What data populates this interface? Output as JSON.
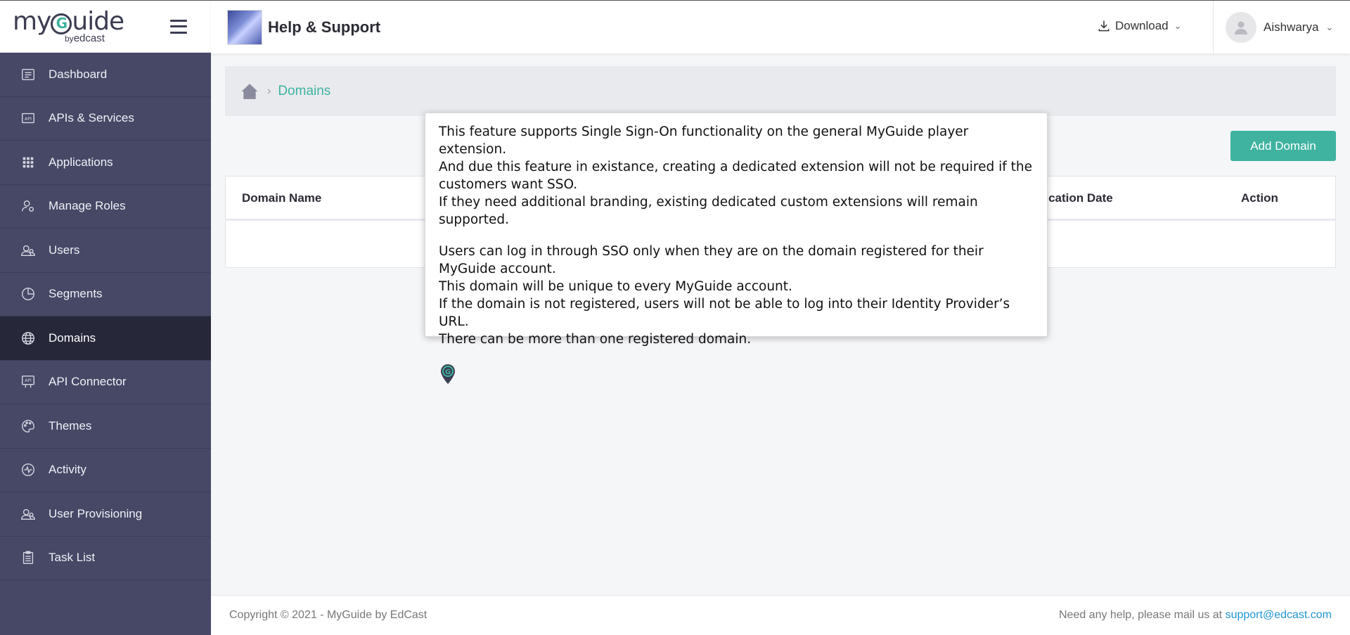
{
  "sidebar": {
    "logo_word_1": "my",
    "logo_g": "G",
    "logo_word_2": "uide",
    "logo_by": "by",
    "logo_brand": "edcast",
    "items": [
      {
        "label": "Dashboard",
        "icon": "dashboard-icon"
      },
      {
        "label": "APIs & Services",
        "icon": "api-icon"
      },
      {
        "label": "Applications",
        "icon": "grid-icon"
      },
      {
        "label": "Manage Roles",
        "icon": "user-gear-icon"
      },
      {
        "label": "Users",
        "icon": "users-icon"
      },
      {
        "label": "Segments",
        "icon": "pie-chart-icon"
      },
      {
        "label": "Domains",
        "icon": "globe-icon",
        "active": true
      },
      {
        "label": "API Connector",
        "icon": "api-connector-icon"
      },
      {
        "label": "Themes",
        "icon": "palette-icon"
      },
      {
        "label": "Activity",
        "icon": "activity-icon"
      },
      {
        "label": "User Provisioning",
        "icon": "users-icon"
      },
      {
        "label": "Task List",
        "icon": "clipboard-icon"
      }
    ]
  },
  "header": {
    "title": "Help & Support",
    "download_label": "Download",
    "user_name": "Aishwarya"
  },
  "breadcrumb": {
    "current": "Domains"
  },
  "actions": {
    "add_domain": "Add Domain"
  },
  "table": {
    "col_domain_name": "Domain Name",
    "col_modification_date": "ification Date",
    "col_action": "Action"
  },
  "tooltip": {
    "line1": "This feature supports Single Sign-On functionality on the general MyGuide player extension.",
    "line2": "And due this feature in existance, creating a dedicated extension will not be required if the customers want SSO.",
    "line3": "If they need additional branding, existing dedicated custom extensions will remain supported.",
    "line4": "Users can log in through SSO only when they are on the domain registered for their MyGuide account.",
    "line5": "This domain will be unique to every MyGuide account.",
    "line6": "If the domain is not registered, users will not be able to log into their Identity Provider’s URL.",
    "line7": "There can be more than one registered domain."
  },
  "footer": {
    "copyright": "Copyright © 2021 - MyGuide by EdCast",
    "help_text": "Need any help, please mail us at ",
    "email": "support@edcast.com"
  },
  "colors": {
    "sidebar_bg": "#474866",
    "sidebar_active": "#262739",
    "accent": "#3fb3a0",
    "link": "#2196d3"
  }
}
